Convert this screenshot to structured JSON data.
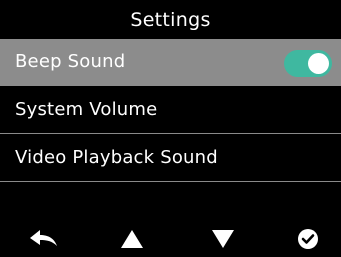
{
  "header": {
    "title": "Settings"
  },
  "menu": {
    "items": [
      {
        "label": "Beep Sound",
        "selected": true,
        "toggle": "on"
      },
      {
        "label": "System Volume"
      },
      {
        "label": "Video Playback Sound"
      }
    ]
  },
  "toggle_color": "#3fb8a0",
  "highlight_color": "#8c8c8c",
  "nav": {
    "icons": [
      "back-arrow-icon",
      "up-triangle-icon",
      "down-triangle-icon",
      "confirm-check-icon"
    ]
  }
}
